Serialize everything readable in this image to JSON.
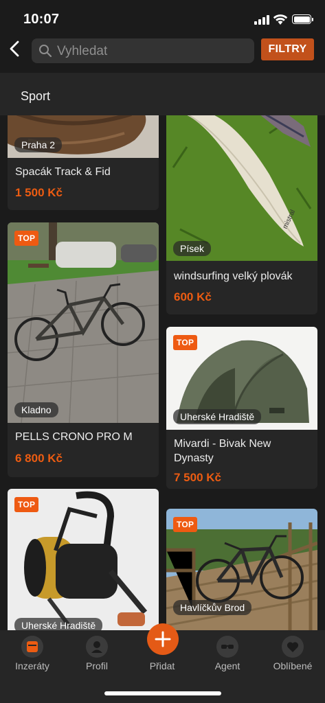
{
  "status": {
    "time": "10:07"
  },
  "header": {
    "search_placeholder": "Vyhledat",
    "filter_label": "FILTRY"
  },
  "category": {
    "label": "Sport"
  },
  "listings": [
    {
      "title": "Spacák Track & Fid",
      "price": "1 500 Kč",
      "location": "Praha 2",
      "top": false
    },
    {
      "title": "windsurfing velký plovák",
      "price": "600 Kč",
      "location": "Písek",
      "top": false
    },
    {
      "title": "PELLS CRONO PRO M",
      "price": "6 800 Kč",
      "location": "Kladno",
      "top": true,
      "badge": "TOP"
    },
    {
      "title_line1": "Mivardi - Bivak New",
      "title_line2": "Dynasty",
      "price": "7 500 Kč",
      "location": "Uherské Hradiště",
      "top": true,
      "badge": "TOP"
    },
    {
      "location": "Uherské Hradiště",
      "top": true,
      "badge": "TOP"
    },
    {
      "location": "Havlíčkův Brod",
      "top": true,
      "badge": "TOP"
    }
  ],
  "tabs": [
    {
      "label": "Inzeráty",
      "icon": "listings-icon",
      "active": true
    },
    {
      "label": "Profil",
      "icon": "profile-icon",
      "active": false
    },
    {
      "label": "Přidat",
      "icon": "plus-icon",
      "active": false
    },
    {
      "label": "Agent",
      "icon": "agent-icon",
      "active": false
    },
    {
      "label": "Oblíbené",
      "icon": "heart-icon",
      "active": false
    }
  ],
  "colors": {
    "accent": "#ec5c12",
    "background": "#1b1b1b",
    "card": "#262626"
  }
}
